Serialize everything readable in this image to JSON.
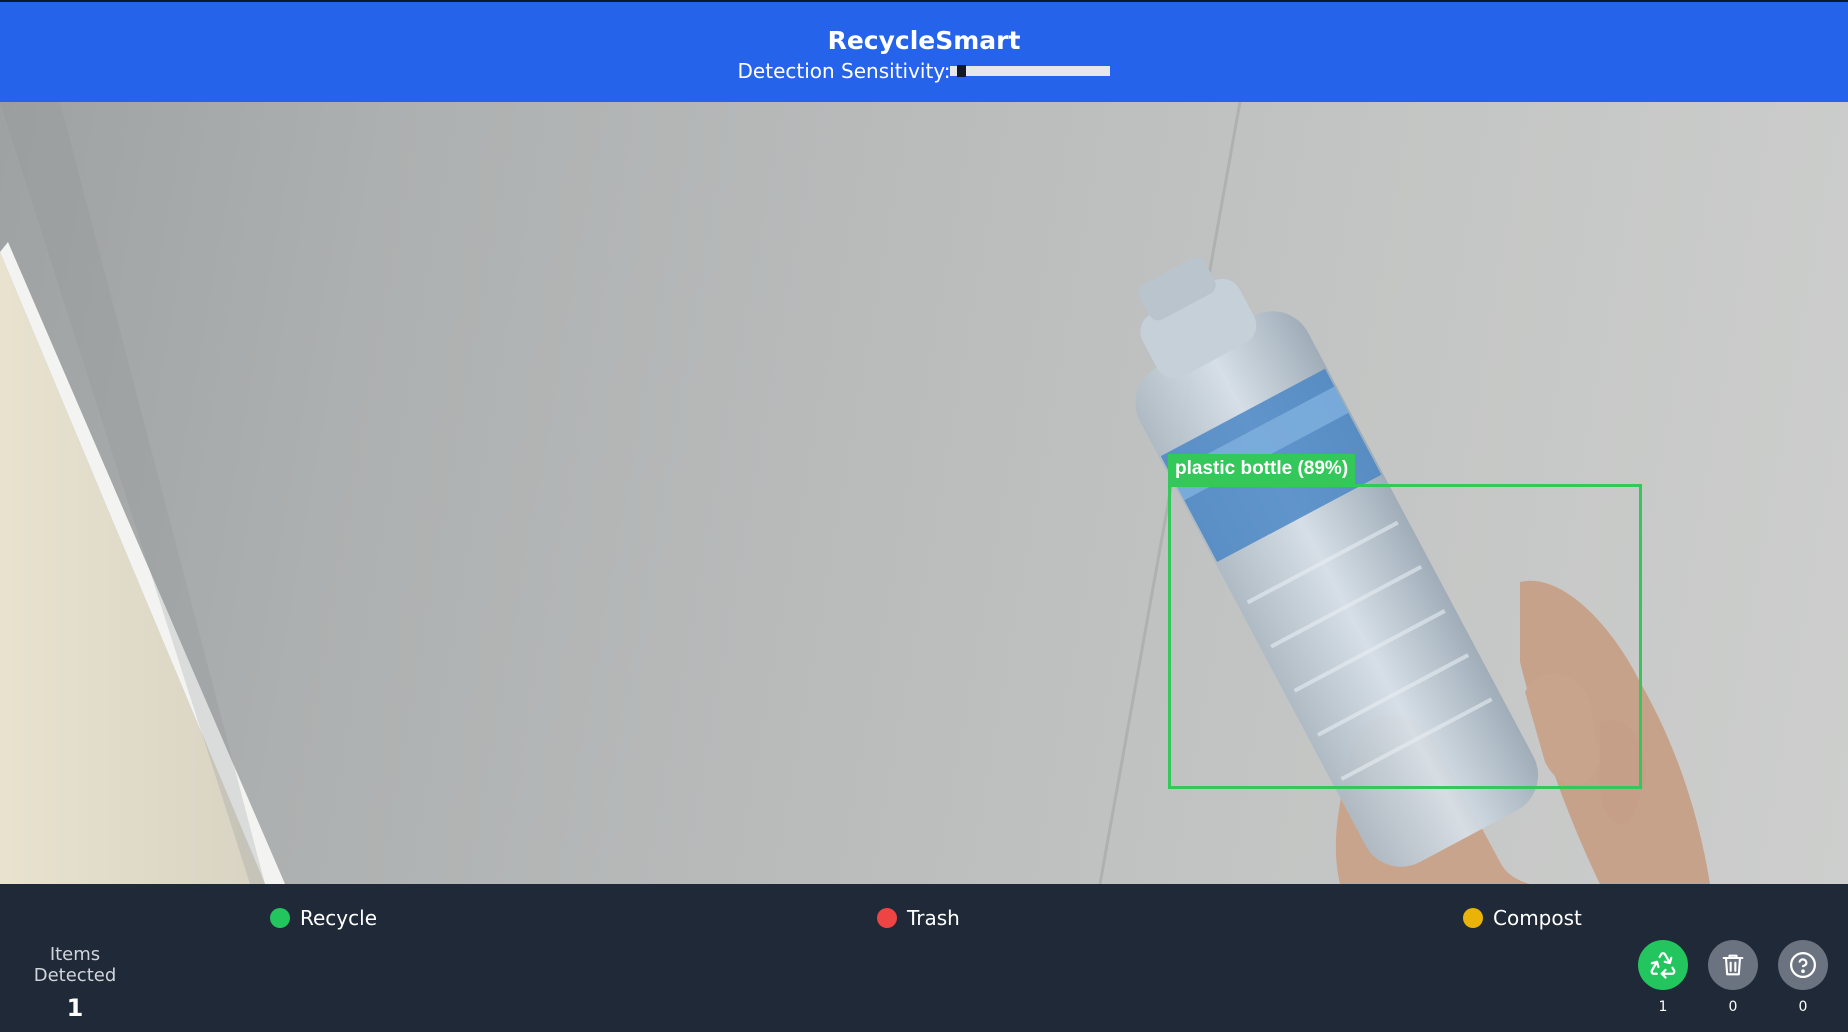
{
  "header": {
    "title": "RecycleSmart",
    "sensitivity_label": "Detection Sensitivity:",
    "sensitivity_value": 0.05
  },
  "detection": {
    "label": "plastic bottle (89%)"
  },
  "legend": {
    "recycle": "Recycle",
    "trash": "Trash",
    "compost": "Compost"
  },
  "colors": {
    "header_bg": "#2563eb",
    "footer_bg": "#1f2937",
    "recycle": "#22c55e",
    "trash": "#ef4444",
    "compost": "#eab308",
    "detection": "#34c759",
    "bin_inactive": "#6b7280"
  },
  "stats": {
    "items_detected_label": "Items Detected",
    "items_detected_value": "1"
  },
  "bins": [
    {
      "name": "recycle",
      "icon": "recycle-icon",
      "count": "1"
    },
    {
      "name": "trash",
      "icon": "trash-icon",
      "count": "0"
    },
    {
      "name": "unknown",
      "icon": "question-icon",
      "count": "0"
    }
  ]
}
